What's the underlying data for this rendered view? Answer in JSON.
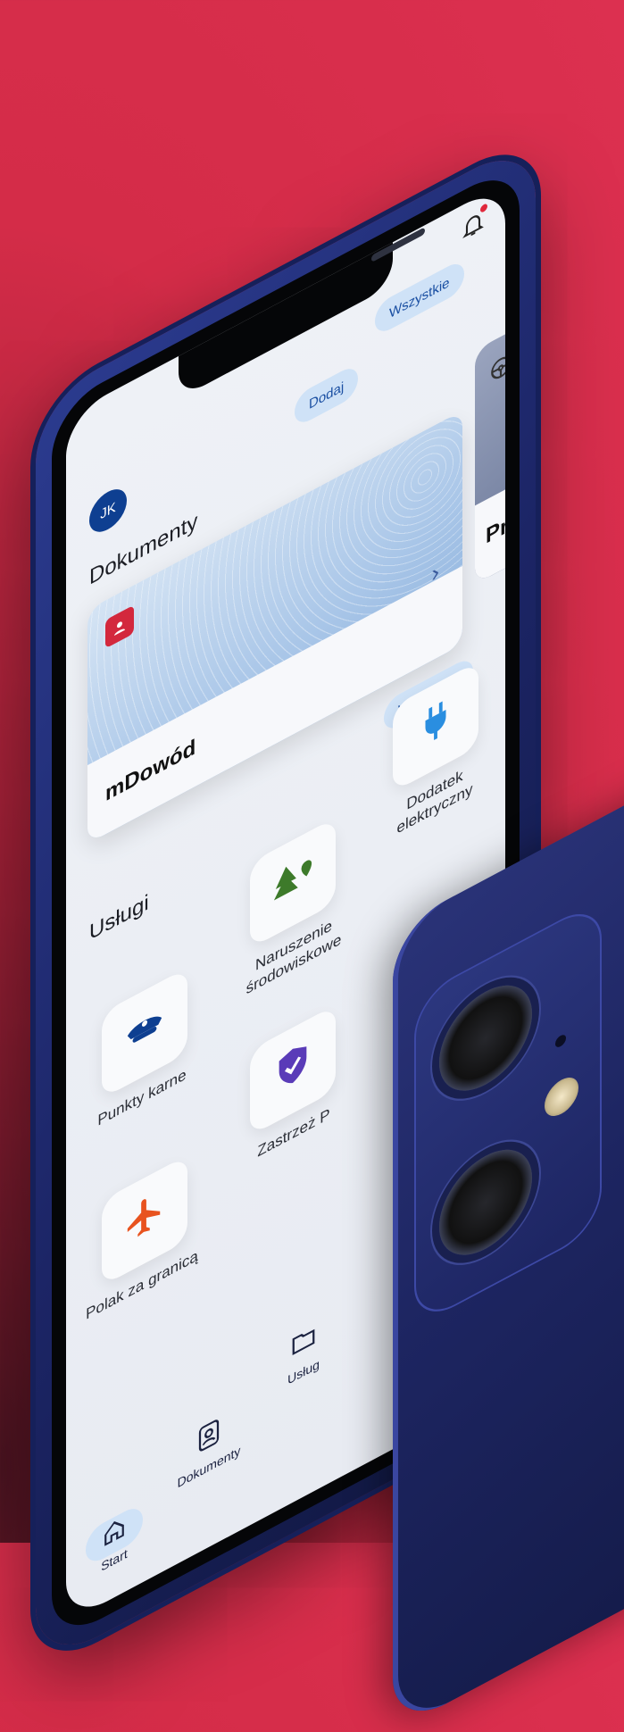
{
  "header": {
    "avatar_initials": "JK",
    "all_label": "Wszystkie",
    "add_label": "Dodaj"
  },
  "documents": {
    "title": "Dokumenty",
    "cards": [
      {
        "name": "mDowód",
        "icon": "id-card-icon"
      },
      {
        "name": "Pra",
        "icon": "steering-wheel-icon"
      }
    ]
  },
  "services": {
    "title": "Usługi",
    "all_label": "Wszystkie",
    "tiles": [
      {
        "label": "Punkty karne",
        "icon": "police-cap-icon",
        "color": "#0e3f91"
      },
      {
        "label": "Naruszenie środowiskowe",
        "icon": "tree-pin-icon",
        "color": "#3d7a2a"
      },
      {
        "label": "Dodatek elektryczny",
        "icon": "plug-icon",
        "color": "#2a8ee0"
      },
      {
        "label": "Polak za granicą",
        "icon": "airplane-icon",
        "color": "#e8531f"
      },
      {
        "label": "Zastrzeż P",
        "icon": "shield-check-icon",
        "color": "#5a3bb8"
      }
    ]
  },
  "tabbar": {
    "tabs": [
      {
        "label": "Start",
        "icon": "home-icon",
        "active": true
      },
      {
        "label": "Dokumenty",
        "icon": "person-card-icon",
        "active": false
      },
      {
        "label": "Usług",
        "icon": "folder-icon",
        "active": false
      }
    ]
  },
  "colors": {
    "background": "#d42c48",
    "phone_body": "#1c2566",
    "accent_blue": "#1a4fa2",
    "pill_bg": "#cfe2f7"
  }
}
